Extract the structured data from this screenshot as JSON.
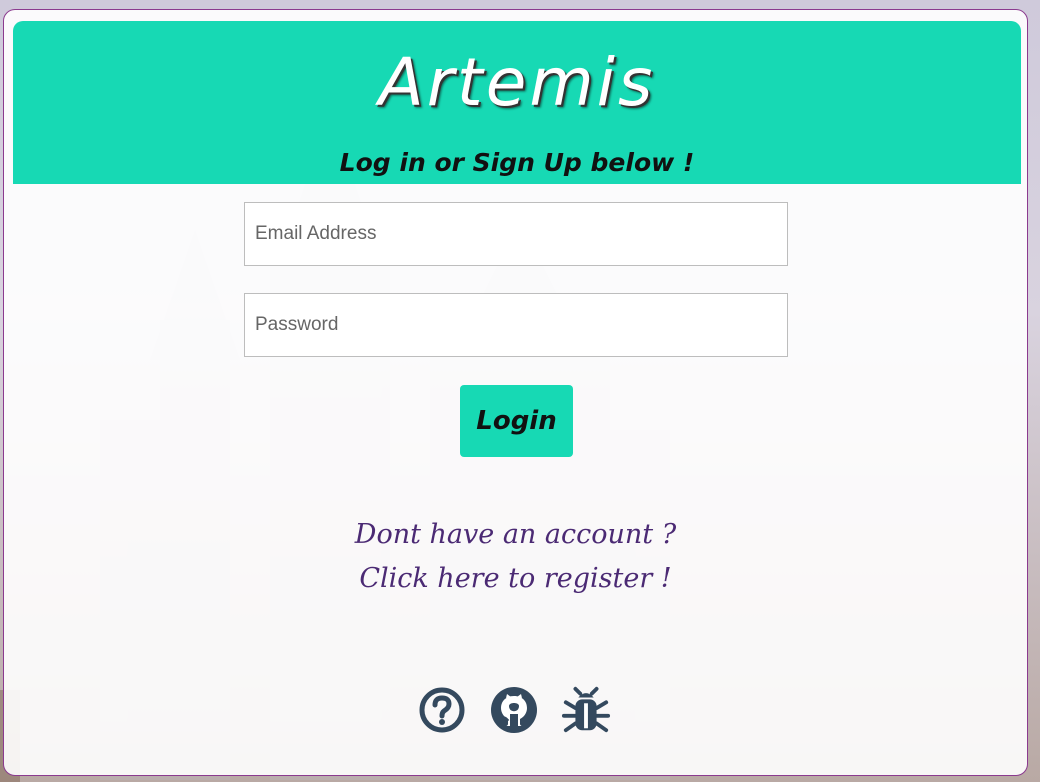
{
  "header": {
    "title": "Artemis",
    "subtitle": "Log in or Sign Up below !"
  },
  "form": {
    "email_placeholder": "Email Address",
    "password_placeholder": "Password",
    "login_label": "Login"
  },
  "register": {
    "line1": "Dont have an account ?",
    "line2": "Click here to register !"
  },
  "footer_icons": [
    "help-icon",
    "github-icon",
    "bug-icon"
  ],
  "colors": {
    "accent": "#17d9b4",
    "link": "#4b2a74",
    "icon": "#34495e",
    "card_border": "#8b3a8f"
  }
}
